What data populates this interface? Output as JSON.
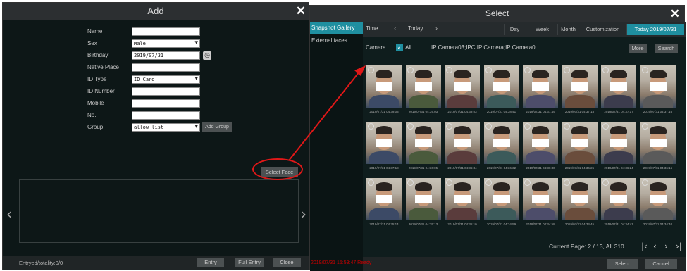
{
  "add_dialog": {
    "title": "Add",
    "fields": [
      {
        "label": "Name",
        "value": ""
      },
      {
        "label": "Sex",
        "value": "Male"
      },
      {
        "label": "Birthday",
        "value": "2019/07/31"
      },
      {
        "label": "Native Place",
        "value": ""
      },
      {
        "label": "ID Type",
        "value": "ID Card"
      },
      {
        "label": "ID Number",
        "value": ""
      },
      {
        "label": "Mobile",
        "value": ""
      },
      {
        "label": "No.",
        "value": ""
      },
      {
        "label": "Group",
        "value": "allow list"
      }
    ],
    "add_group_label": "Add Group",
    "select_face_label": "Select Face",
    "entry_totality": "Entryed/totality:0/0",
    "entry_label": "Entry",
    "full_entry_label": "Full Entry",
    "close_label": "Close"
  },
  "select_dialog": {
    "title": "Select",
    "sidebar": [
      "Snapshot Gallery",
      "External faces"
    ],
    "time_label": "Time",
    "today_label": "Today",
    "range_tabs": [
      "Day",
      "Week",
      "Month",
      "Customization",
      "Today 2019/07/31"
    ],
    "camera_label": "Camera",
    "all_label": "All",
    "camera_list": "IP Camera03;IPC;IP Camera;IP Camera0...",
    "more_label": "More",
    "search_label": "Search",
    "thumbnails": [
      "2019/07/31 04:39:03",
      "2019/07/31 04:39:03",
      "2019/07/31 04:39:03",
      "2019/07/31 04:38:41",
      "2019/07/31 04:37:49",
      "2019/07/31 04:37:18",
      "2019/07/31 04:37:17",
      "2019/07/31 04:37:16",
      "2019/07/31 04:37:18",
      "2019/07/31 04:36:05",
      "2019/07/31 04:36:34",
      "2019/07/31 04:36:32",
      "2019/07/31 04:36:30",
      "2019/07/31 04:36:25",
      "2019/07/31 04:36:24",
      "2019/07/31 04:36:16",
      "2019/07/31 04:35:14",
      "2019/07/31 04:35:13",
      "2019/07/31 04:35:10",
      "2019/07/31 04:34:59",
      "2019/07/31 04:34:58",
      "2019/07/31 04:34:45",
      "2019/07/31 04:34:41",
      "2019/07/31 04:34:40"
    ],
    "page_info": "Current Page: 2 / 13, All 310",
    "select_label": "Select",
    "cancel_label": "Cancel",
    "status_text": "2019/07/31 15:59:47 Ready"
  },
  "colors": {
    "accent": "#1f8fa0",
    "annotation": "#e01818"
  }
}
